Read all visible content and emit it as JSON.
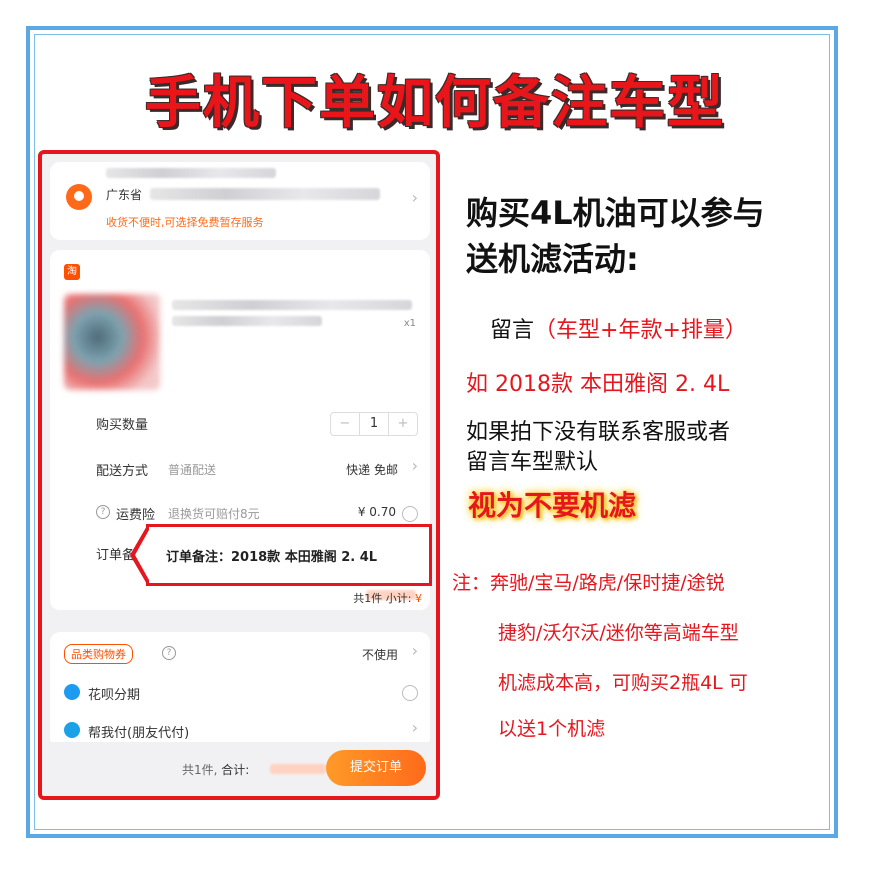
{
  "title": "手机下单如何备注车型",
  "phone": {
    "address": {
      "province": "广东省",
      "note": "收货不便时,可选择免费暂存服务"
    },
    "product": {
      "store_icon": "淘",
      "qty_mark": "x1"
    },
    "rows": {
      "quantity_label": "购买数量",
      "quantity_value": "1",
      "minus": "−",
      "plus": "+",
      "delivery_label": "配送方式",
      "delivery_sub": "普通配送",
      "delivery_value": "快递 免邮",
      "insurance_label": "运费险",
      "insurance_sub": "退换货可赔付8元",
      "insurance_price": "¥ 0.70",
      "remark_label": "订单备"
    },
    "callout": "订单备注：2018款  本田雅阁  2. 4L",
    "subtotal": {
      "count": "共1件",
      "label": "小计:",
      "currency": "¥"
    },
    "payments": {
      "coupon_tag": "品类购物券",
      "coupon_value": "不使用",
      "huabei_label": "花呗分期",
      "friend_pay_label": "帮我付(朋友代付)"
    },
    "bottom_bar": {
      "count": "共1件,",
      "total_label": "合计:",
      "submit_label": "提交订单"
    }
  },
  "right": {
    "headline_1": "购买4L机油可以参与",
    "headline_2": "送机滤活动:",
    "msg_prefix": "留言",
    "msg_paren": "（车型+年款+排量）",
    "example": "如 2018款  本田雅阁  2. 4L",
    "warning_1": "如果拍下没有联系客服或者",
    "warning_2": "留言车型默认",
    "highlight": "视为不要机滤",
    "note_1": "注：奔驰/宝马/路虎/保时捷/途锐",
    "note_2": "捷豹/沃尔沃/迷你等高端车型",
    "note_3": "机滤成本高，可购买2瓶4L 可",
    "note_4": "以送1个机滤"
  },
  "colors": {
    "accent": "#e5161e",
    "orange": "#ff6a1a",
    "frame": "#5aa9e6"
  }
}
